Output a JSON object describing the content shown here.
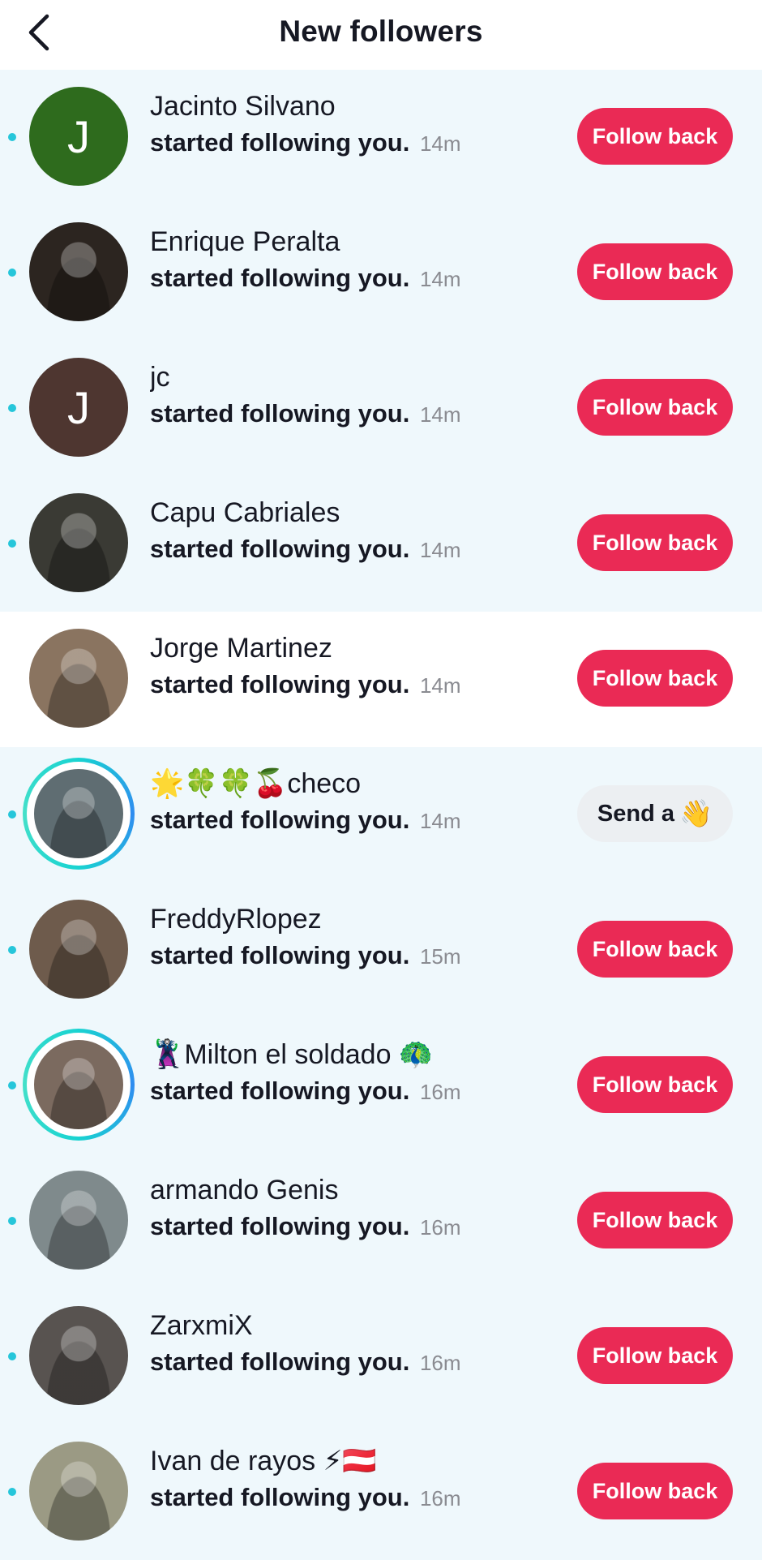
{
  "header": {
    "title": "New followers",
    "back_icon": "chevron-left-icon"
  },
  "colors": {
    "accent": "#ea2a55",
    "unread_background": "#eff8fc",
    "unread_dot": "#26c6da",
    "story_ring": "#19d3d1"
  },
  "activity_text": "started following you.",
  "follow_back_label": "Follow back",
  "wave_button": {
    "label": "Send a",
    "emoji": "👋"
  },
  "followers": [
    {
      "name": "Jacinto Silvano",
      "time": "14m",
      "avatar_initial": "J",
      "avatar_color": "#2e6b1d",
      "unread": true,
      "story": false,
      "action": "follow"
    },
    {
      "name": "Enrique Peralta",
      "time": "14m",
      "avatar_initial": "",
      "avatar_color": "#2c2520",
      "unread": true,
      "story": false,
      "action": "follow"
    },
    {
      "name": "jc",
      "time": "14m",
      "avatar_initial": "J",
      "avatar_color": "#4e3630",
      "unread": true,
      "story": false,
      "action": "follow"
    },
    {
      "name": "Capu Cabriales",
      "time": "14m",
      "avatar_initial": "",
      "avatar_color": "#3a3a34",
      "unread": true,
      "story": false,
      "action": "follow"
    },
    {
      "name": "Jorge Martinez",
      "time": "14m",
      "avatar_initial": "",
      "avatar_color": "#8a7460",
      "unread": false,
      "story": false,
      "action": "follow"
    },
    {
      "name": "🌟🍀🍀🍒checo",
      "time": "14m",
      "avatar_initial": "",
      "avatar_color": "#5f6d72",
      "unread": true,
      "story": true,
      "action": "wave"
    },
    {
      "name": "FreddyRlopez",
      "time": "15m",
      "avatar_initial": "",
      "avatar_color": "#6e5b4c",
      "unread": true,
      "story": false,
      "action": "follow"
    },
    {
      "name": "🦹Milton el soldado 🦚",
      "time": "16m",
      "avatar_initial": "",
      "avatar_color": "#7b6a5f",
      "unread": true,
      "story": true,
      "action": "follow"
    },
    {
      "name": "armando Genis",
      "time": "16m",
      "avatar_initial": "",
      "avatar_color": "#7f8a8c",
      "unread": true,
      "story": false,
      "action": "follow"
    },
    {
      "name": "ZarxmiX",
      "time": "16m",
      "avatar_initial": "",
      "avatar_color": "#585350",
      "unread": true,
      "story": false,
      "action": "follow"
    },
    {
      "name": "Ivan de rayos ⚡🇦🇹",
      "time": "16m",
      "avatar_initial": "",
      "avatar_color": "#9b9a84",
      "unread": true,
      "story": false,
      "action": "follow"
    }
  ]
}
